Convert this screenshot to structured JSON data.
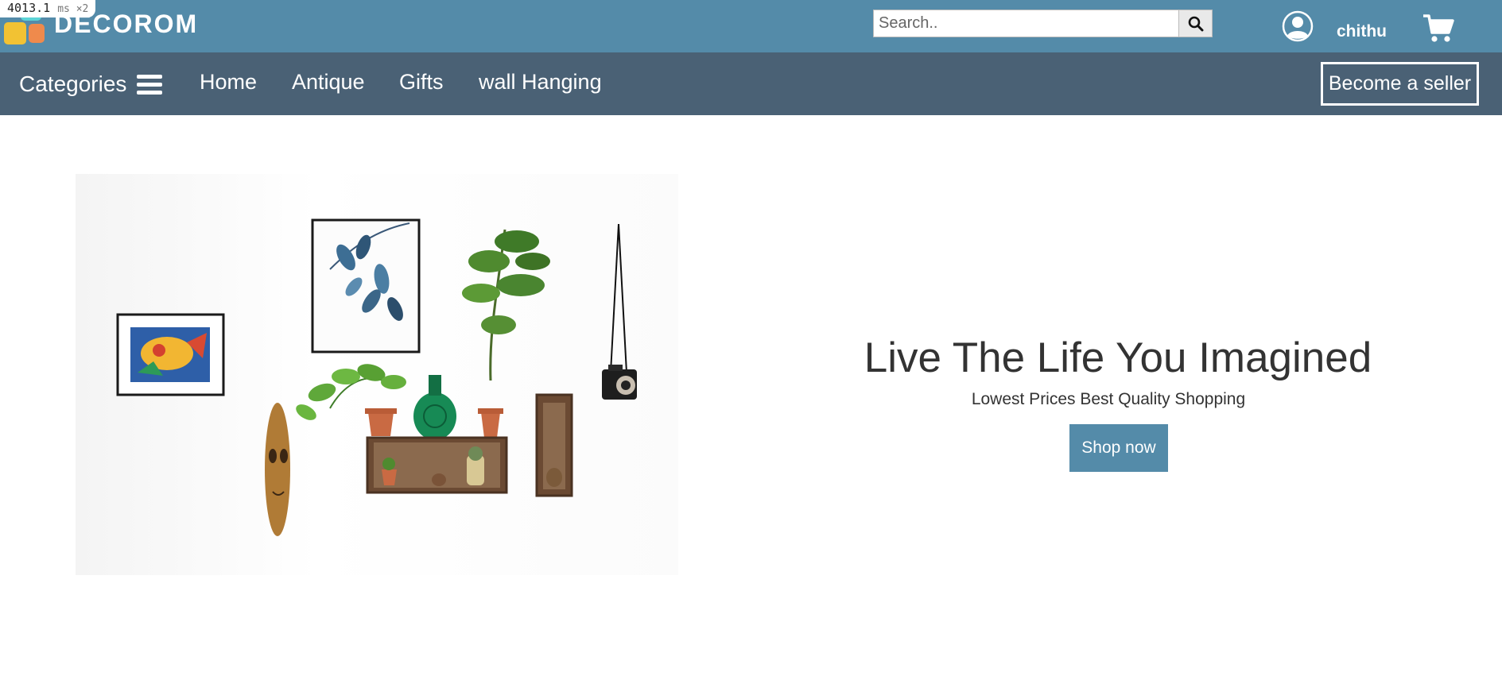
{
  "debug": {
    "timing_value": "4013.1",
    "timing_unit": "ms ×2"
  },
  "header": {
    "brand": "DECOROM",
    "search": {
      "placeholder": "Search..",
      "value": ""
    },
    "user_name": "chithu",
    "colors": {
      "topbar": "#548ba9",
      "navbar": "#4a6175"
    }
  },
  "nav": {
    "categories_label": "Categories",
    "links": [
      "Home",
      "Antique",
      "Gifts",
      "wall Hanging"
    ],
    "seller_button": "Become a seller"
  },
  "hero": {
    "title": "Live The Life You Imagined",
    "subtitle": "Lowest Prices Best Quality Shopping",
    "cta": "Shop now",
    "image_description_icon": "wall-decor-photo"
  },
  "icons": {
    "search": "search-icon",
    "user": "user-icon",
    "cart": "cart-icon",
    "menu": "hamburger-icon"
  }
}
